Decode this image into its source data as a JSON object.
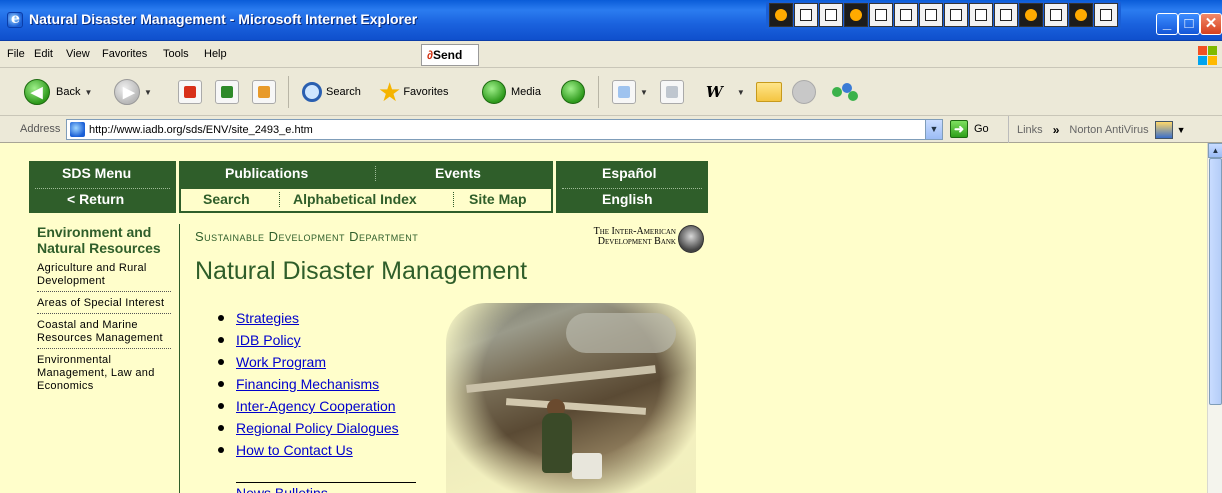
{
  "window": {
    "title": "Natural Disaster Management - Microsoft Internet Explorer",
    "controls": {
      "minimize": "_",
      "maximize": "□",
      "close": "✕"
    }
  },
  "menu": [
    "File",
    "Edit",
    "View",
    "Favorites",
    "Tools",
    "Help"
  ],
  "send_button": "Send",
  "toolbar": {
    "back": "Back",
    "search": "Search",
    "favorites": "Favorites",
    "media": "Media"
  },
  "address": {
    "label": "Address",
    "url": "http://www.iadb.org/sds/ENV/site_2493_e.htm",
    "go": "Go",
    "links": "Links",
    "norton": "Norton AntiVirus"
  },
  "site_nav": {
    "sds_menu": "SDS Menu",
    "return": "< Return",
    "publications": "Publications",
    "events": "Events",
    "search": "Search",
    "alpha_index": "Alphabetical Index",
    "site_map": "Site Map",
    "espanol": "Español",
    "english": "English"
  },
  "sidebar": {
    "heading": "Environment and Natural Resources",
    "items": [
      "Agriculture and Rural Development",
      "Areas of Special Interest",
      "Coastal and Marine Resources Management",
      "Environmental Management, Law and Economics"
    ]
  },
  "page": {
    "department": "Sustainable Development Department",
    "bank": "The Inter-American Development Bank",
    "title": "Natural Disaster Management",
    "links": [
      "Strategies",
      "IDB Policy",
      "Work Program",
      "Financing Mechanisms",
      "Inter-Agency Cooperation",
      "Regional Policy Dialogues",
      "How to Contact Us"
    ],
    "news": "News Bulletins"
  }
}
